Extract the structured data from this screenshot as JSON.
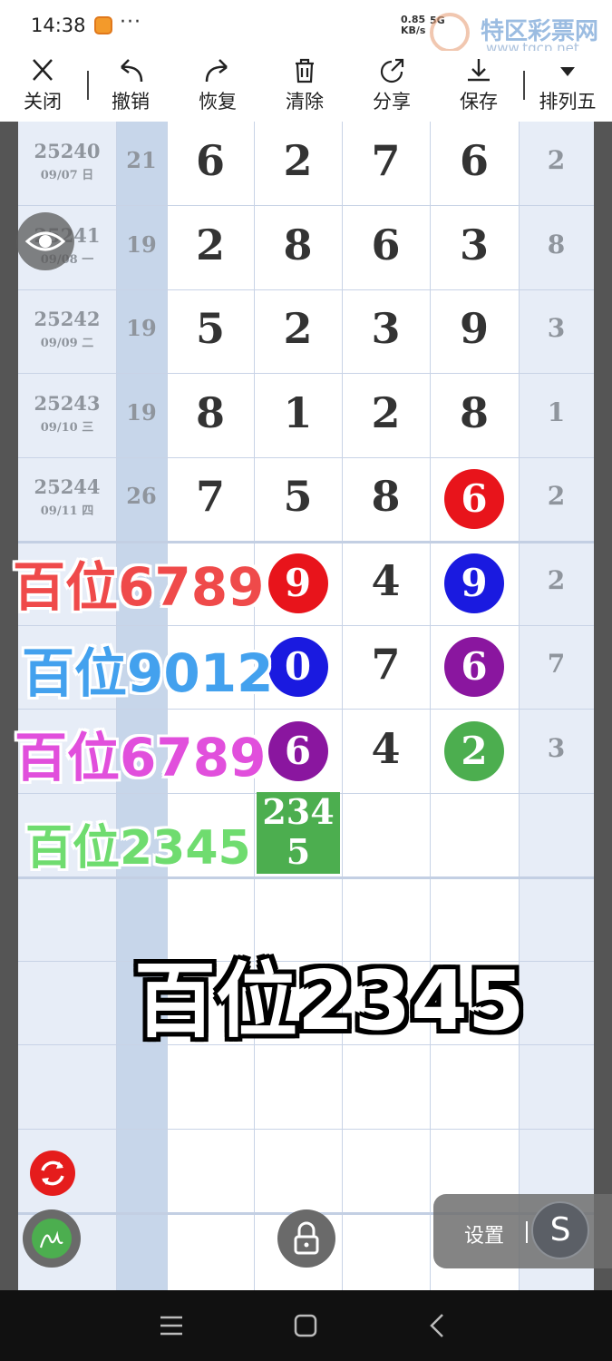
{
  "status": {
    "time": "14:38",
    "net_speed_top": "0.85",
    "net_speed_unit": "KB/s",
    "net_type": "5G",
    "dots": "···"
  },
  "watermark": {
    "text": "特区彩票网",
    "url": "www.tqcp.net"
  },
  "toolbar": {
    "close": "关闭",
    "undo": "撤销",
    "redo": "恢复",
    "clear": "清除",
    "share": "分享",
    "save": "保存",
    "mode": "排列五"
  },
  "rows": [
    {
      "issue": "25240",
      "date": "09/07 日",
      "sum": "21",
      "d1": "6",
      "d2": "2",
      "d3": "7",
      "d4": "6",
      "span": "2"
    },
    {
      "issue": "25241",
      "date": "09/08 一",
      "sum": "19",
      "d1": "2",
      "d2": "8",
      "d3": "6",
      "d4": "3",
      "span": "8"
    },
    {
      "issue": "25242",
      "date": "09/09 二",
      "sum": "19",
      "d1": "5",
      "d2": "2",
      "d3": "3",
      "d4": "9",
      "span": "3"
    },
    {
      "issue": "25243",
      "date": "09/10 三",
      "sum": "19",
      "d1": "8",
      "d2": "1",
      "d3": "2",
      "d4": "8",
      "span": "1"
    },
    {
      "issue": "25244",
      "date": "09/11 四",
      "sum": "26",
      "d1": "7",
      "d2": "5",
      "d3": "8",
      "d4": "6",
      "span": "2"
    },
    {
      "d2": "9",
      "d3": "4",
      "d4": "9",
      "span": "2"
    },
    {
      "d2": "0",
      "d3": "7",
      "d4": "6",
      "span": "7"
    },
    {
      "d2": "6",
      "d3": "4",
      "d4": "2",
      "span": "3"
    }
  ],
  "green_box": {
    "line1": "234",
    "line2": "5"
  },
  "overlays": {
    "red": "百位6789",
    "blue": "百位9012",
    "magenta": "百位6789",
    "green": "百位2345",
    "big": "百位2345"
  },
  "settings": {
    "label": "设置",
    "s": "S"
  },
  "colors": {
    "red": "#e8141b",
    "blue": "#1a1ae0",
    "purple": "#8a169f",
    "green": "#4cae4f",
    "col_highlight": "#c7d6ea"
  }
}
